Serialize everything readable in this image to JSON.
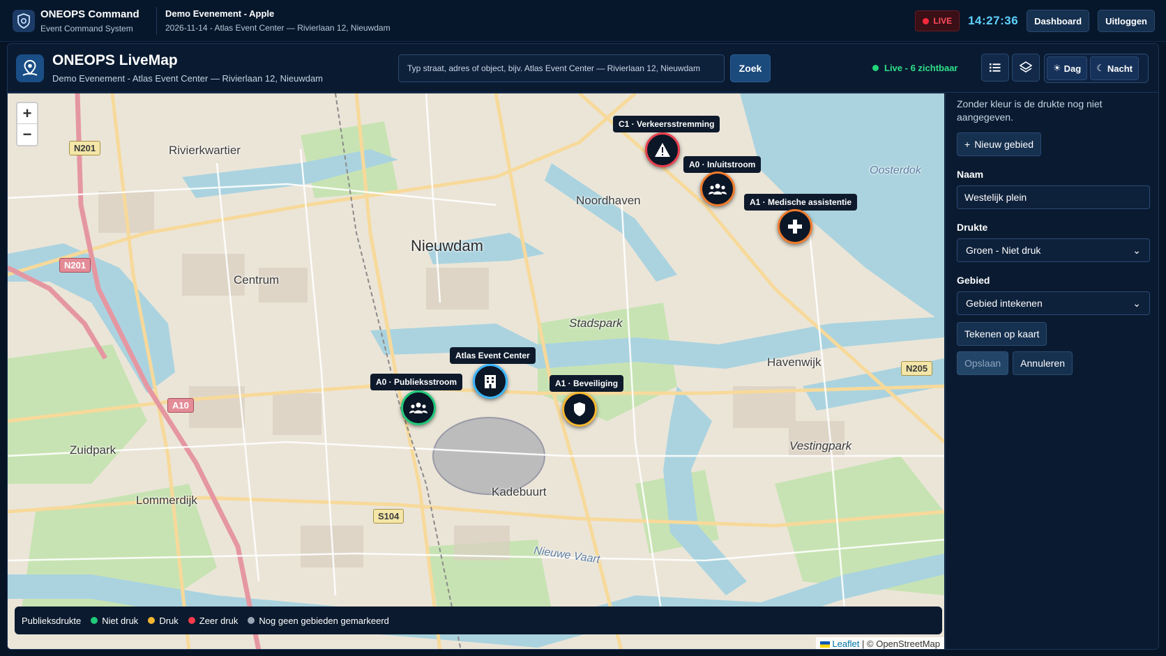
{
  "topbar": {
    "app_title": "ONEOPS Command",
    "app_subtitle": "Event Command System",
    "event_title": "Demo Evenement - Apple",
    "event_subtitle": "2026-11-14 - Atlas Event Center — Rivierlaan 12, Nieuwdam",
    "live_label": "LIVE",
    "clock": "14:27:36",
    "dashboard_label": "Dashboard",
    "logout_label": "Uitloggen"
  },
  "map_header": {
    "title": "ONEOPS LiveMap",
    "subtitle": "Demo Evenement - Atlas Event Center — Rivierlaan 12, Nieuwdam",
    "search_placeholder": "Typ straat, adres of object, bijv. Atlas Event Center — Rivierlaan 12, Nieuwdam",
    "search_button": "Zoek",
    "live_status": "Live - 6 zichtbaar",
    "day_label": "Dag",
    "night_label": "Nacht"
  },
  "map": {
    "zoom_in": "+",
    "zoom_out": "−",
    "places": {
      "rivierkwartier": "Rivierkwartier",
      "noordhaven": "Noordhaven",
      "oosterdok": "Oosterdok",
      "nieuwdam": "Nieuwdam",
      "centrum": "Centrum",
      "stadspark": "Stadspark",
      "havenwijk": "Havenwijk",
      "zuidpark": "Zuidpark",
      "vestingpark": "Vestingpark",
      "lommerdijk": "Lommerdijk",
      "kadebuurt": "Kadebuurt",
      "nieuwe_vaart": "Nieuwe Vaart"
    },
    "road_shields": {
      "n201_a": "N201",
      "n201_b": "N201",
      "a10": "A10",
      "n205": "N205",
      "s104": "S104"
    },
    "markers": {
      "verkeer": "C1 · Verkeersstremming",
      "instroom": "A0 · In/uitstroom",
      "medisch": "A1 · Medische assistentie",
      "atlas": "Atlas Event Center",
      "publiek": "A0 · Publieksstroom",
      "beveiliging": "A1 · Beveiliging"
    },
    "legend": {
      "title": "Publieksdrukte",
      "items": [
        "Niet druk",
        "Druk",
        "Zeer druk",
        "Nog geen gebieden gemarkeerd"
      ],
      "colors": [
        "#22c97a",
        "#f5b731",
        "#ff3b4a",
        "#9aa6b6"
      ]
    },
    "attribution_leaflet": "Leaflet",
    "attribution_osm": "| © OpenStreetMap"
  },
  "panel": {
    "note": "Zonder kleur is de drukte nog niet aangegeven.",
    "new_area": "Nieuw gebied",
    "name_label": "Naam",
    "name_value": "Westelijk plein",
    "crowd_label": "Drukte",
    "crowd_value": "Groen - Niet druk",
    "area_label": "Gebied",
    "area_value": "Gebied intekenen",
    "draw_button": "Tekenen op kaart",
    "save_button": "Opslaan",
    "cancel_button": "Annuleren"
  }
}
